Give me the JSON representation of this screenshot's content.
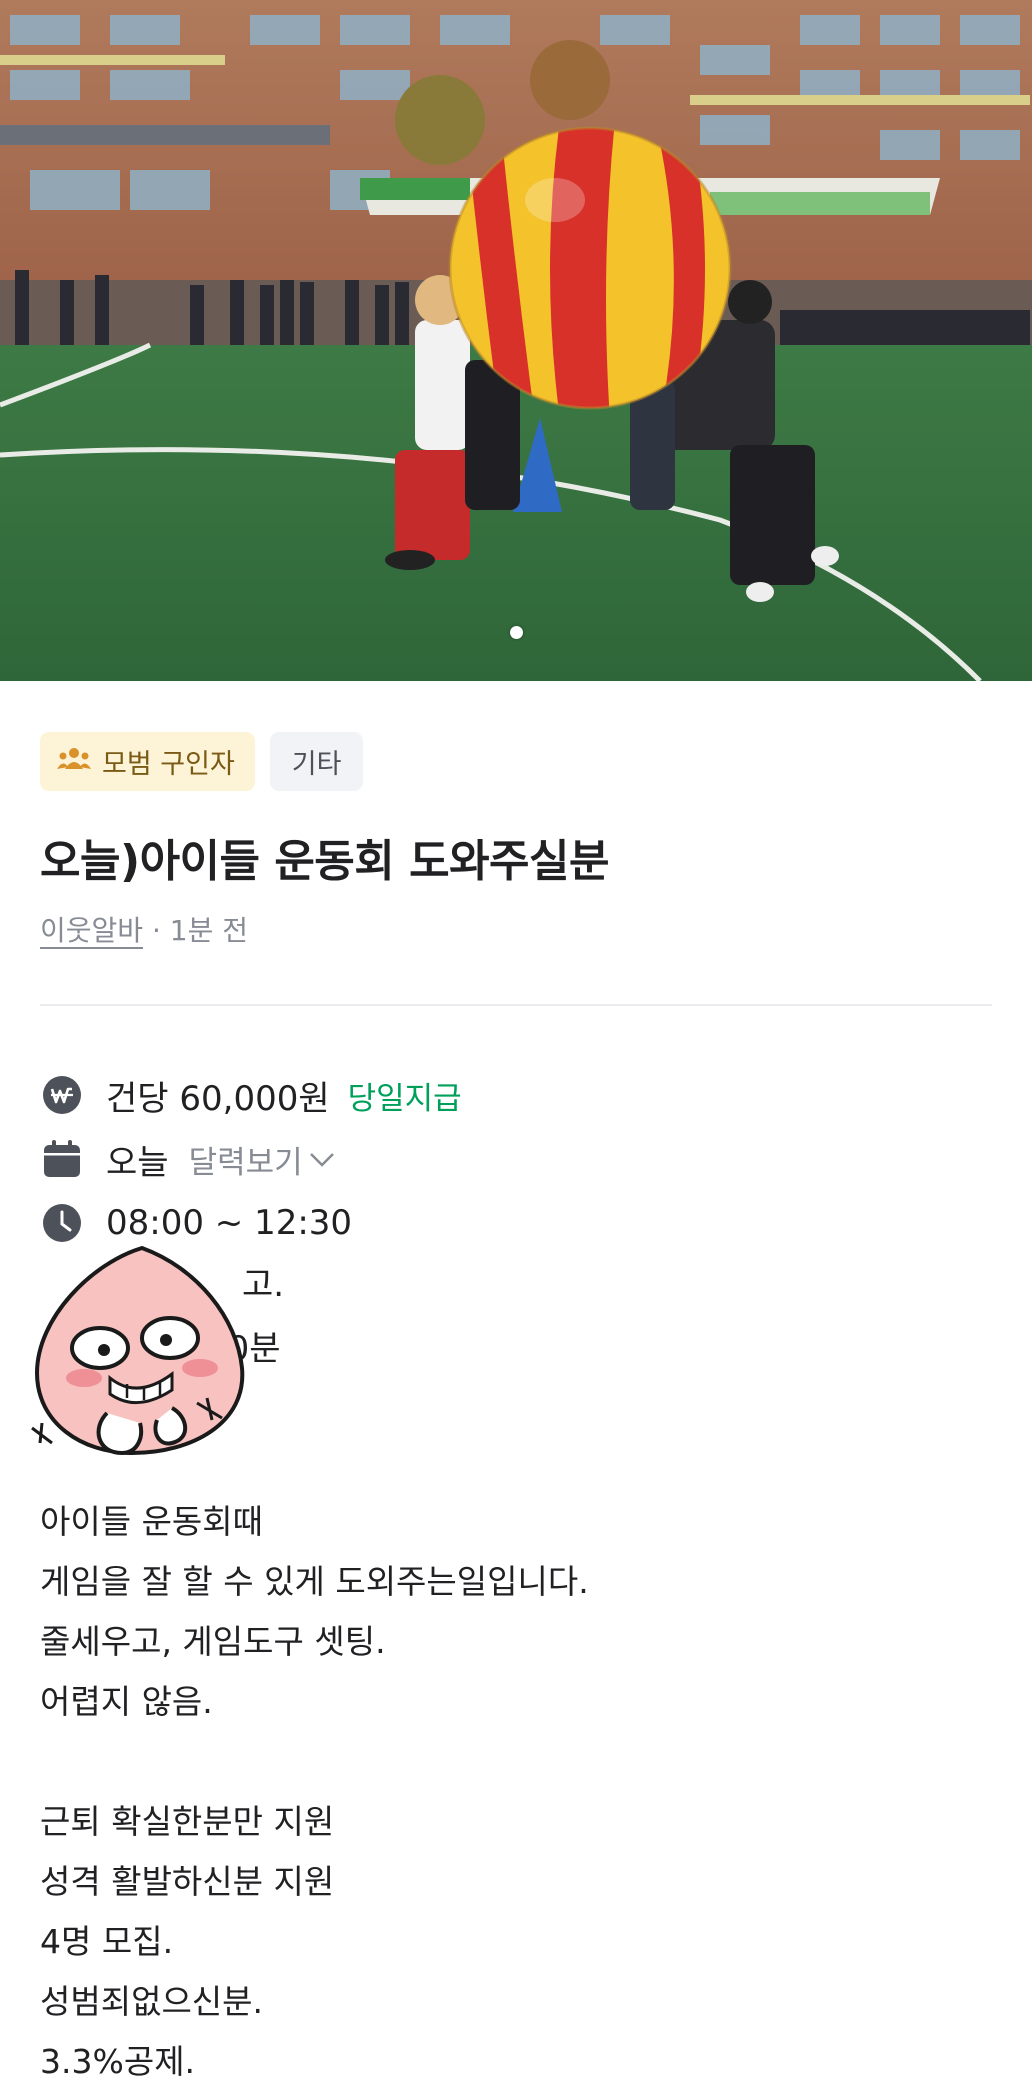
{
  "carousel": {
    "total_images": 1,
    "current_index": 1
  },
  "badges": [
    {
      "label": "모범 구인자",
      "icon": "people-icon",
      "color": "#fdf3d6"
    },
    {
      "label": "기타",
      "icon": "",
      "color": "#f2f3f6"
    }
  ],
  "post": {
    "title": "오늘)아이들 운동회 도와주실분",
    "author": "이웃알바",
    "separator": " · ",
    "time_ago": "1분 전"
  },
  "details": {
    "wage": {
      "icon": "won-icon",
      "amount": "건당 60,000원",
      "payment": "당일지급",
      "payment_color": "#00a05b"
    },
    "date": {
      "icon": "calendar-icon",
      "value": "오늘",
      "calendar_link": "달력보기"
    },
    "time": {
      "icon": "clock-icon",
      "value": "08:00 ~ 12:30"
    },
    "partial_rows": [
      "고.",
      "30분"
    ]
  },
  "description": [
    "아이들 운동회때",
    "게임을 잘 할 수 있게 도외주는일입니다.",
    "줄세우고, 게임도구 셋팅.",
    "어렵지 않음.",
    "",
    "근퇴 확실한분만 지원",
    "성격 활발하신분 지원",
    "4명 모집.",
    "성범죄없으신분.",
    "3.3%공제."
  ]
}
